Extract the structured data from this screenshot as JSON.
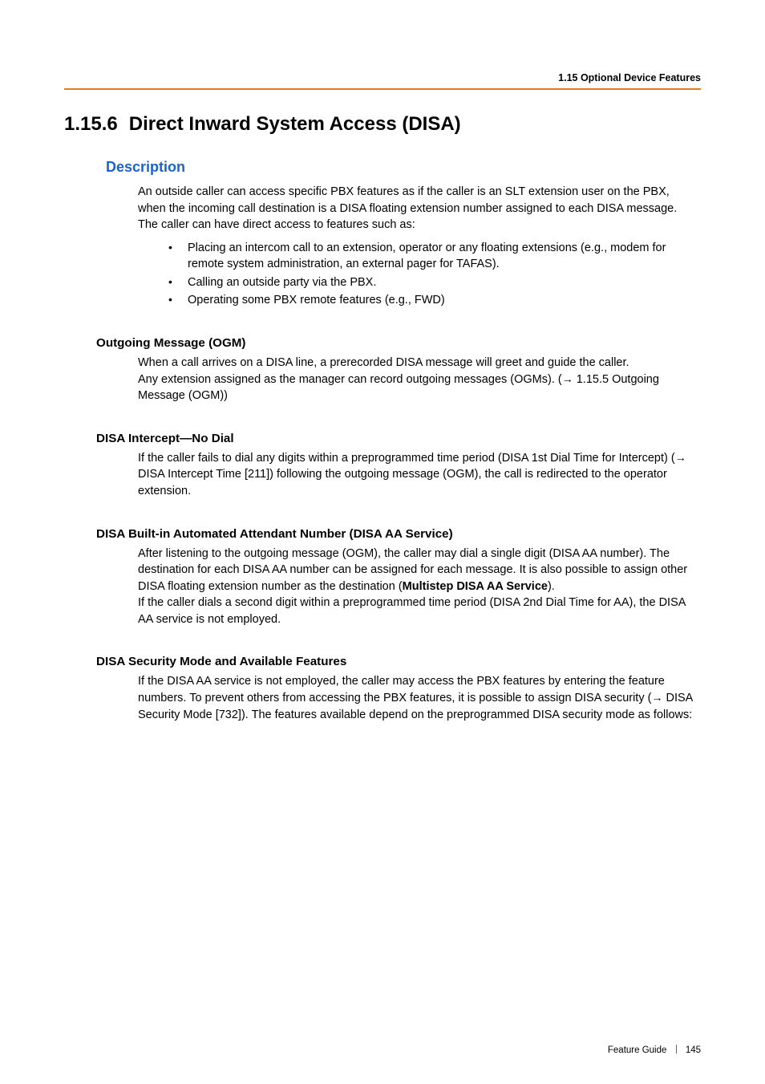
{
  "header": {
    "running_head": "1.15 Optional Device Features"
  },
  "title": {
    "number": "1.15.6",
    "text": "Direct Inward System Access (DISA)"
  },
  "description": {
    "heading": "Description",
    "intro": "An outside caller can access specific PBX features as if the caller is an SLT extension user on the PBX, when the incoming call destination is a DISA floating extension number assigned to each DISA message. The caller can have direct access to features such as:",
    "bullets": [
      "Placing an intercom call to an extension, operator or any floating extensions (e.g., modem for remote system administration, an external pager for TAFAS).",
      "Calling an outside party via the PBX.",
      "Operating some PBX remote features (e.g., FWD)"
    ]
  },
  "sections": {
    "ogm": {
      "heading": "Outgoing Message (OGM)",
      "body1": "When a call arrives on a DISA line, a prerecorded DISA message will greet and guide the caller.",
      "body2a": "Any extension assigned as the manager can record outgoing messages (OGMs). (",
      "body2b": " 1.15.5 Outgoing Message (OGM))"
    },
    "nodial": {
      "heading": "DISA Intercept—No Dial",
      "body_a": "If the caller fails to dial any digits within a preprogrammed time period (DISA 1st Dial Time for Intercept) (",
      "body_b": " DISA Intercept Time [211]) following the outgoing message (OGM), the call is redirected to the operator extension."
    },
    "aa": {
      "heading": "DISA Built-in Automated Attendant Number (DISA AA Service)",
      "body1a": "After listening to the outgoing message (OGM), the caller may dial a single digit (DISA AA number). The destination for each DISA AA number can be assigned for each message. It is also possible to assign other DISA floating extension number as the destination (",
      "body1_bold": "Multistep DISA AA Service",
      "body1b": ").",
      "body2": "If the caller dials a second digit within a preprogrammed time period (DISA 2nd Dial Time for AA), the DISA AA service is not employed."
    },
    "security": {
      "heading": "DISA Security Mode and Available Features",
      "body_a": "If the DISA AA service is not employed, the caller may access the PBX features by entering the feature numbers. To prevent others from accessing the PBX features, it is possible to assign DISA security (",
      "body_b": " DISA Security Mode [732]). The features available depend on the preprogrammed DISA security mode as follows:"
    }
  },
  "footer": {
    "label": "Feature Guide",
    "page": "145"
  },
  "glyphs": {
    "arrow": "→"
  }
}
